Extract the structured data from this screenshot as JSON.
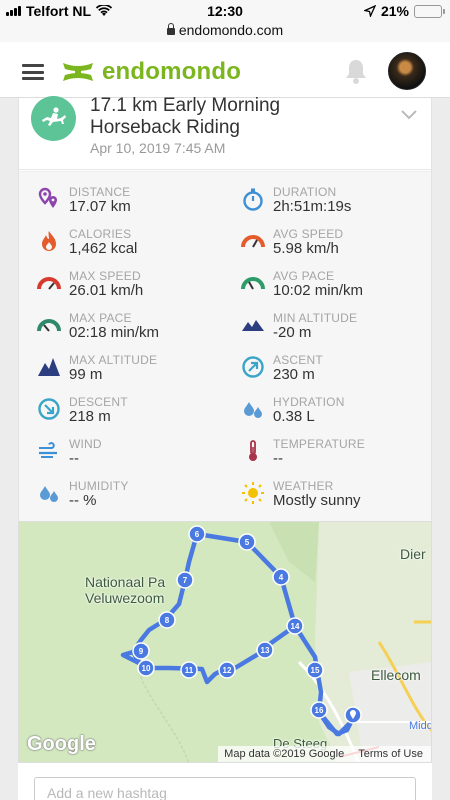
{
  "status_bar": {
    "carrier": "Telfort NL",
    "time": "12:30",
    "battery": "21%",
    "battery_level": 0.21
  },
  "url_bar": {
    "domain": "endomondo.com"
  },
  "header": {
    "logo_text": "endomondo",
    "menu_icon": "hamburger-icon",
    "bell_icon": "bell-icon"
  },
  "workout": {
    "title_line1": "17.1 km Early Morning",
    "title_line2": "Horseback Riding",
    "date": "Apr 10, 2019 7:45 AM"
  },
  "stats": [
    {
      "label": "DISTANCE",
      "value": "17.07 km",
      "icon": "distance-pin-icon",
      "color": "#8e44ad"
    },
    {
      "label": "DURATION",
      "value": "2h:51m:19s",
      "icon": "stopwatch-icon",
      "color": "#3d8fd6"
    },
    {
      "label": "CALORIES",
      "value": "1,462 kcal",
      "icon": "flame-icon",
      "color": "#e45b2c"
    },
    {
      "label": "AVG SPEED",
      "value": "5.98 km/h",
      "icon": "speedometer-icon",
      "color": "#e45b2c"
    },
    {
      "label": "MAX SPEED",
      "value": "26.01 km/h",
      "icon": "speedometer-icon",
      "color": "#d63b2f"
    },
    {
      "label": "AVG PACE",
      "value": "10:02 min/km",
      "icon": "pace-gauge-icon",
      "color": "#2e9c6a"
    },
    {
      "label": "MAX PACE",
      "value": "02:18 min/km",
      "icon": "pace-gauge-icon",
      "color": "#2e8a6a"
    },
    {
      "label": "MIN ALTITUDE",
      "value": "-20 m",
      "icon": "mountain-icon",
      "color": "#2c3e80"
    },
    {
      "label": "MAX ALTITUDE",
      "value": "99 m",
      "icon": "mountain-icon",
      "color": "#2c3e80"
    },
    {
      "label": "ASCENT",
      "value": "230 m",
      "icon": "ascent-arrow-icon",
      "color": "#3aa5c8"
    },
    {
      "label": "DESCENT",
      "value": "218 m",
      "icon": "descent-arrow-icon",
      "color": "#3aa5c8"
    },
    {
      "label": "HYDRATION",
      "value": "0.38 L",
      "icon": "water-drops-icon",
      "color": "#5b9bd5"
    },
    {
      "label": "WIND",
      "value": "--",
      "icon": "wind-icon",
      "color": "#3d8fd6"
    },
    {
      "label": "TEMPERATURE",
      "value": "--",
      "icon": "thermometer-icon",
      "color": "#a8334a"
    },
    {
      "label": "HUMIDITY",
      "value": "-- %",
      "icon": "water-drops-icon",
      "color": "#5b9bd5"
    },
    {
      "label": "WEATHER",
      "value": "Mostly sunny",
      "icon": "sun-icon",
      "color": "#f2c200"
    }
  ],
  "map": {
    "labels": {
      "park_line1": "Nationaal Pa",
      "park_line2": "Veluwezoom",
      "town_ellecom": "Ellecom",
      "town_dier": "Dier",
      "town_midd": "Midd",
      "town_desteeg": "De Steeg"
    },
    "google": "Google",
    "map_data": "Map data ©2019 Google",
    "terms": "Terms of Use",
    "markers": [
      "4",
      "5",
      "6",
      "7",
      "8",
      "9",
      "10",
      "11",
      "12",
      "13",
      "14",
      "15",
      "16"
    ],
    "route_color": "#4a79e2"
  },
  "hashtag": {
    "placeholder": "Add a new hashtag"
  }
}
